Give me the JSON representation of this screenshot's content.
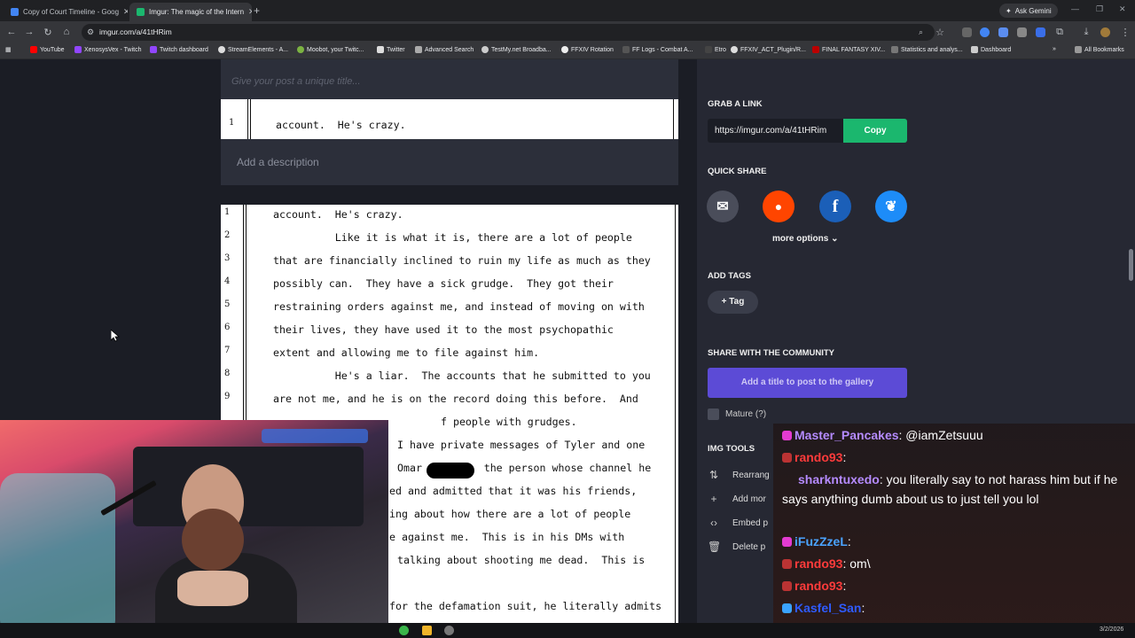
{
  "browser": {
    "tabs": [
      {
        "title": "Copy of Court Timeline - Goog",
        "active": false
      },
      {
        "title": "Imgur: The magic of the Intern",
        "active": true
      }
    ],
    "ask_gemini": "Ask Gemini",
    "url": "imgur.com/a/41tHRim",
    "bookmarks": [
      "YouTube",
      "XenosysVex - Twitch",
      "Twitch dashboard",
      "StreamElements - A...",
      "Moobot, your Twitc...",
      "Twitter",
      "Advanced Search",
      "TestMy.net Broadba...",
      "FFXIV Rotation",
      "FF Logs - Combat A...",
      "Etro",
      "FFXIV_ACT_Plugin/R...",
      "FINAL FANTASY XIV...",
      "Statistics and analys...",
      "Dashboard"
    ],
    "all_bookmarks": "All Bookmarks"
  },
  "editor": {
    "title_placeholder": "Give your post a unique title...",
    "description_placeholder": "Add a description",
    "image1": {
      "line_numbers": [
        "1"
      ],
      "lines": [
        "account.  He's crazy."
      ]
    },
    "image2": {
      "line_numbers": [
        "1",
        "2",
        "3",
        "4",
        "5",
        "6",
        "7",
        "8",
        "9"
      ],
      "lines": [
        "account.  He's crazy.",
        "          Like it is what it is, there are a lot of people",
        "that are financially inclined to ruin my life as much as they",
        "possibly can.  They have a sick grudge.  They got their",
        "restraining orders against me, and instead of moving on with",
        "their lives, they have used it to the most psychopathic",
        "extent and allowing me to file against him.",
        "          He's a liar.  The accounts that he submitted to you",
        "are not me, and he is on the record doing this before.  And",
        "f people with grudges.",
        "I have private messages of Tyler and one",
        "Omar          the person whose channel he",
        "ed and admitted that it was his friends,",
        "ing about how there are a lot of people",
        "e against me.  This is in his DMs with",
        "talking about shooting me dead.  This is",
        "for the defamation suit, he literally admits"
      ]
    }
  },
  "panel": {
    "grab_link_heading": "GRAB A LINK",
    "link_value": "https://imgur.com/a/41tHRim",
    "copy_label": "Copy",
    "quick_share_heading": "QUICK SHARE",
    "more_options": "more options",
    "add_tags_heading": "ADD TAGS",
    "tag_label": "Tag",
    "community_heading": "SHARE WITH THE COMMUNITY",
    "gallery_button": "Add a title to post to the gallery",
    "mature_label": "Mature (?)",
    "img_tools_heading": "IMG TOOLS",
    "tools": [
      "Rearrang",
      "Add mor",
      "Embed p",
      "Delete p"
    ]
  },
  "chat": {
    "messages": [
      {
        "user": "Master_Pancakes",
        "color": "#b58bff",
        "text": ": @iamZetsuuu"
      },
      {
        "user": "rando93",
        "color": "#ff3b3b",
        "text": ":"
      },
      {
        "user": "sharkntuxedo",
        "color": "#b58bff",
        "text": ": you literally say to not harass him but if he says anything dumb about us to just tell you lol"
      },
      {
        "user": "iFuzZzeL",
        "color": "#4aa3ff",
        "text": ":"
      },
      {
        "user": "rando93",
        "color": "#ff3b3b",
        "text": ": om\\"
      },
      {
        "user": "rando93",
        "color": "#ff3b3b",
        "text": ": "
      },
      {
        "user": "Kasfel_San",
        "color": "#2f5bff",
        "text": ":"
      }
    ]
  },
  "taskbar": {
    "date": "3/2/2026"
  },
  "colors": {
    "copy_green": "#1bb76e",
    "gallery_purple": "#5c4bd6",
    "reddit": "#ff4500",
    "facebook": "#1b5fb8",
    "bluesky": "#1d8cf8"
  }
}
